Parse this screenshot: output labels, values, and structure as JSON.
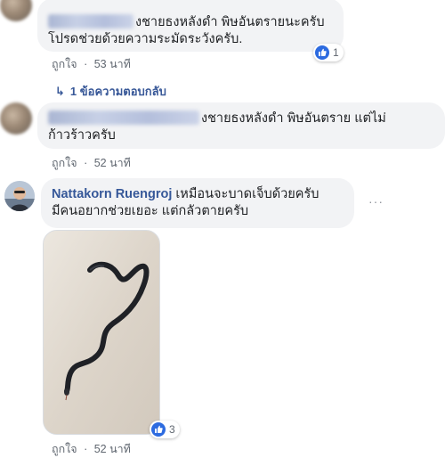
{
  "comments": [
    {
      "text_line1": "งชายธงหลังดำ พิษอันตรายนะครับ",
      "text_line2": "โปรดช่วยด้วยความระมัดระวังครับ.",
      "like_label": "ถูกใจ",
      "separator": "·",
      "time": "53 นาที",
      "reaction_count": "1",
      "replies_label": "1 ข้อความตอบกลับ"
    },
    {
      "text_line1": "งชายธงหลังดำ พิษอันตราย แต่ไม่",
      "text_line2": "ก้าวร้าวครับ",
      "like_label": "ถูกใจ",
      "separator": "·",
      "time": "52 นาที"
    },
    {
      "author": "Nattakorn Ruengroj",
      "text_line1": "เหมือนจะบาดเจ็บด้วยครับ",
      "text_line2": "มีคนอยากช่วยเยอะ แต่กลัวตายครับ",
      "options_label": "···",
      "like_label": "ถูกใจ",
      "separator": "·",
      "time": "52 นาที",
      "reaction_count": "3"
    }
  ],
  "colors": {
    "link": "#365899",
    "bubble": "#f2f3f5",
    "like_blue": "#2d6be0",
    "meta": "#606770"
  },
  "icons": {
    "reaction": "thumbs-up-icon",
    "reply": "reply-arrow-icon"
  },
  "photo": {
    "subject": "snake"
  }
}
